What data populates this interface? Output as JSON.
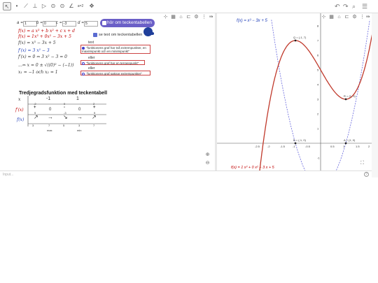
{
  "toolbar": {
    "tools": [
      "↖",
      "•",
      "⟋",
      "⊥",
      "▷",
      "⊙",
      "⊙",
      "∠",
      "a=2",
      "✥"
    ],
    "undo_icon": "undo-icon",
    "redo_icon": "redo-icon",
    "search_icon": "search-icon",
    "menu_icon": "menu-icon",
    "undo": "↶",
    "redo": "↷",
    "search": "⌕",
    "menu": "☰"
  },
  "sliders": [
    {
      "name": "a",
      "value": "1"
    },
    {
      "name": "b",
      "value": "0"
    },
    {
      "name": "c",
      "value": "-3"
    },
    {
      "name": "d",
      "value": "5"
    }
  ],
  "button_label": "hör om teckentabellen",
  "checkbox_label": "se text om teckentabellen",
  "math_lines": [
    "f(x) = a x³ + b x² + c x + d",
    "f(x) = 1x³ + 0x² − 3x + 5",
    "f(x) = x³ − 3x + 5",
    "f′(x) = 3 x² − 3",
    "f′(x) = 0   ⇔   3 x² − 3 = 0",
    "...⇔   x = 0 ± √((0)² − (−1))",
    "x₁ = −1 och x₂ = 1"
  ],
  "text_label": "text",
  "options": [
    "\"funktionens graf har två extrempunkter, en maxiimipunkt och en minimipunkt\"",
    "eller",
    "\"funktionens graf har en terrasspunkt\"",
    "eller",
    "\"funktionens graf saknar extrempunkter\""
  ],
  "table": {
    "title": "Tredjegradsfunktion med teckentabell",
    "row_x": [
      "x",
      "-1",
      "1"
    ],
    "row_x_sub": [
      "-2",
      "0",
      "2"
    ],
    "row_fp": [
      "f′(x)",
      "+",
      "0",
      "-",
      "0",
      "+"
    ],
    "row_fp_sub": [
      "9",
      "-3",
      "9"
    ],
    "row_f": [
      "f(x)",
      "↗",
      "→",
      "↘",
      "→",
      "↗"
    ],
    "row_f_vals": [
      "3",
      "7",
      "5",
      "3",
      "7"
    ],
    "row_f_sub": [
      "max",
      "min"
    ]
  },
  "graph": {
    "label_f": "f(x) = x³ − 3x + 5",
    "label_fp": "f′(x) = 3 x² − 3",
    "label_full": "f(x) = 1 x³ + 0 x² − 3 x + 5",
    "point_max": "Q = (-1, 7)",
    "point_min": "R = (1, 3)",
    "point_a": "A = (1, 0)",
    "point_b": "B = (-1, 0)",
    "point_c": "C = (0, -3)",
    "x_ticks": [
      "-2.5",
      "-2",
      "-1.5",
      "-1",
      "-0.5",
      "0",
      "0.5",
      "1",
      "1.5",
      "2",
      "2.5"
    ],
    "y_ticks": [
      "-1",
      "1",
      "2",
      "3",
      "4",
      "5",
      "6",
      "7",
      "8"
    ],
    "curve_color": "#c0392b",
    "deriv_color": "#6666dd"
  },
  "input_placeholder": "Input..."
}
